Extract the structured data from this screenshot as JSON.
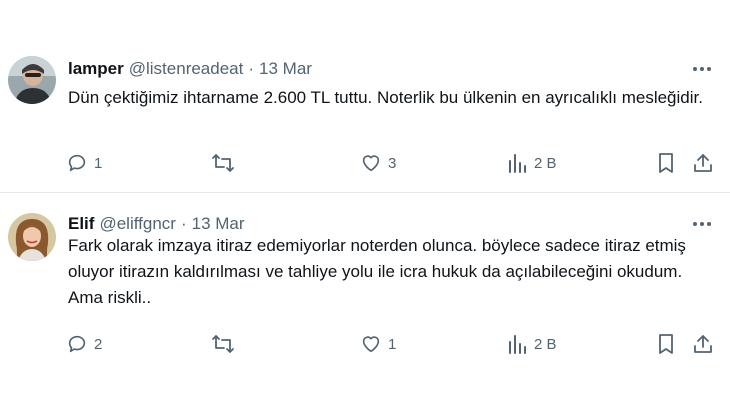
{
  "tweets": [
    {
      "name": "lamper",
      "handle": "@listenreadeat",
      "separator": "·",
      "date": "13 Mar",
      "text": "Dün çektiğimiz ihtarname 2.600 TL tuttu. Noterlik bu ülkenin en ayrıcalıklı mesleğidir.",
      "replies": "1",
      "retweets": "",
      "likes": "3",
      "views": "2 B"
    },
    {
      "name": "Elif",
      "handle": "@eliffgncr",
      "separator": "·",
      "date": "13 Mar",
      "text": "Fark olarak imzaya itiraz edemiyorlar noterden olunca. böylece sadece itiraz etmiş oluyor itirazın kaldırılması ve tahliye yolu ile icra hukuk da açılabileceğini okudum. Ama riskli..",
      "replies": "2",
      "retweets": "",
      "likes": "1",
      "views": "2 B"
    }
  ],
  "icons": {
    "more": "more-horizontal-icon",
    "reply": "reply-icon",
    "retweet": "retweet-icon",
    "like": "heart-icon",
    "views": "views-icon",
    "bookmark": "bookmark-icon",
    "share": "share-icon"
  },
  "colors": {
    "text": "#0f1419",
    "secondary": "#536471",
    "divider": "#e6e9eb"
  }
}
